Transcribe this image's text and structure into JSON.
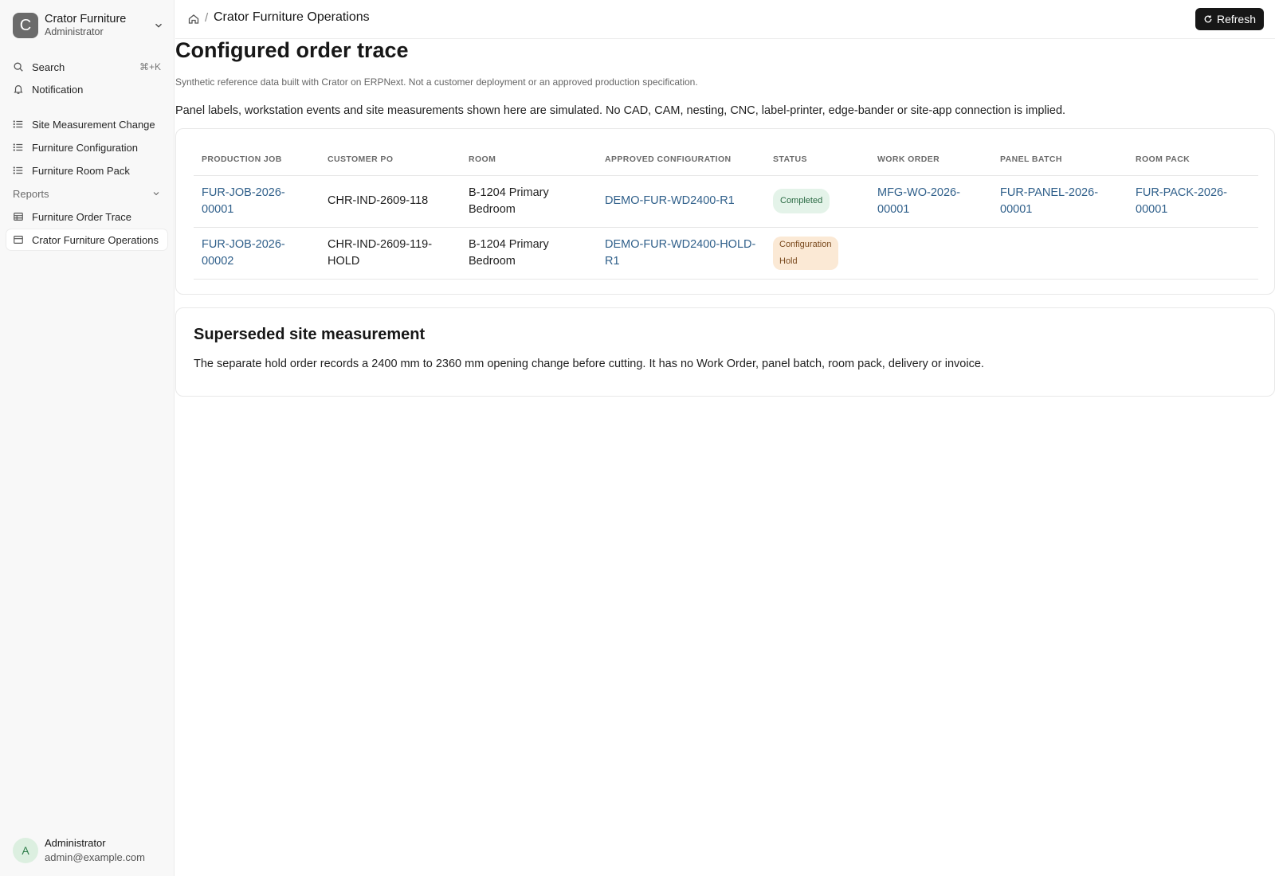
{
  "workspace": {
    "initial": "C",
    "name": "Crator Furniture",
    "role": "Administrator"
  },
  "sidebar": {
    "search_label": "Search",
    "search_shortcut": "⌘+K",
    "notification_label": "Notification",
    "items": [
      {
        "label": "Site Measurement Change",
        "icon": "list-icon"
      },
      {
        "label": "Furniture Configuration",
        "icon": "list-icon"
      },
      {
        "label": "Furniture Room Pack",
        "icon": "list-icon"
      }
    ],
    "reports_section": "Reports",
    "reports": [
      {
        "label": "Furniture Order Trace",
        "icon": "table-icon"
      },
      {
        "label": "Crator Furniture Operations",
        "icon": "page-icon",
        "active": true
      }
    ]
  },
  "user": {
    "initial": "A",
    "name": "Administrator",
    "email": "admin@example.com"
  },
  "header": {
    "breadcrumb_sep": "/",
    "title": "Crator Furniture Operations",
    "refresh_label": "Refresh"
  },
  "main": {
    "title": "Configured order trace",
    "disclaimer": "Synthetic reference data built with Crator on ERPNext. Not a customer deployment or an approved production specification.",
    "note": "Panel labels, workstation events and site measurements shown here are simulated. No CAD, CAM, nesting, CNC, label-printer, edge-bander or site-app connection is implied."
  },
  "table": {
    "columns": [
      "PRODUCTION JOB",
      "CUSTOMER PO",
      "ROOM",
      "APPROVED CONFIGURATION",
      "STATUS",
      "WORK ORDER",
      "PANEL BATCH",
      "ROOM PACK"
    ],
    "rows": [
      {
        "production_job": "FUR-JOB-2026-00001",
        "customer_po": "CHR-IND-2609-118",
        "room": "B-1204 Primary Bedroom",
        "configuration": "DEMO-FUR-WD2400-R1",
        "status": "Completed",
        "work_order": "MFG-WO-2026-00001",
        "panel_batch": "FUR-PANEL-2026-00001",
        "room_pack": "FUR-PACK-2026-00001"
      },
      {
        "production_job": "FUR-JOB-2026-00002",
        "customer_po": "CHR-IND-2609-119-HOLD",
        "room": "B-1204 Primary Bedroom",
        "configuration": "DEMO-FUR-WD2400-HOLD-R1",
        "status": "Configuration Hold",
        "work_order": "",
        "panel_batch": "",
        "room_pack": ""
      }
    ]
  },
  "superseded": {
    "title": "Superseded site measurement",
    "body": "The separate hold order records a 2400 mm to 2360 mm opening change before cutting. It has no Work Order, panel batch, room pack, delivery or invoice."
  }
}
